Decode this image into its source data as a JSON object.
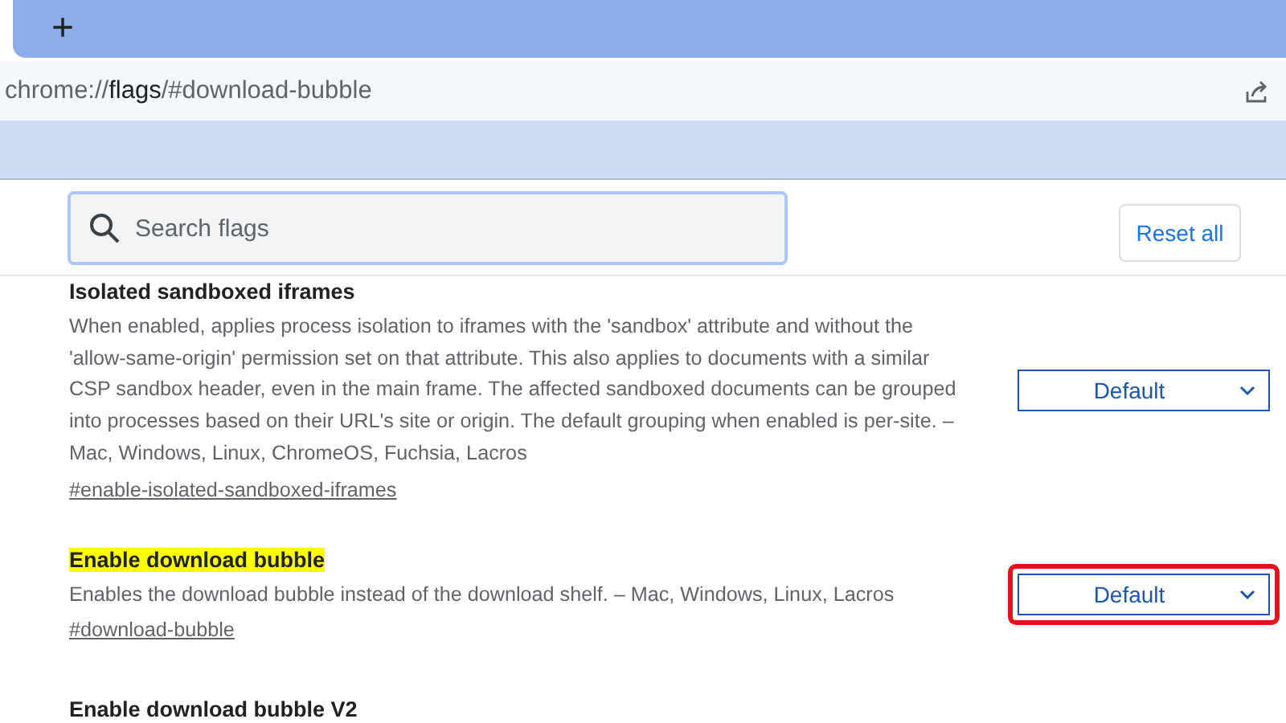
{
  "tab_strip": {
    "new_tab": "+"
  },
  "address_bar": {
    "scheme": "chrome://",
    "host": "flags",
    "path": "/#download-bubble"
  },
  "search": {
    "placeholder": "Search flags"
  },
  "reset_button": "Reset all",
  "flags": [
    {
      "title": "Isolated sandboxed iframes",
      "description": "When enabled, applies process isolation to iframes with the 'sandbox' attribute and without the 'allow-same-origin' permission set on that attribute. This also applies to documents with a similar CSP sandbox header, even in the main frame. The affected sandboxed documents can be grouped into processes based on their URL's site or origin. The default grouping when enabled is per-site. – Mac, Windows, Linux, ChromeOS, Fuchsia, Lacros",
      "link": "#enable-isolated-sandboxed-iframes",
      "value": "Default",
      "highlighted": false,
      "outlined": false
    },
    {
      "title": "Enable download bubble",
      "description": "Enables the download bubble instead of the download shelf. – Mac, Windows, Linux, Lacros",
      "link": "#download-bubble",
      "value": "Default",
      "highlighted": true,
      "outlined": true
    },
    {
      "title": "Enable download bubble V2"
    }
  ]
}
